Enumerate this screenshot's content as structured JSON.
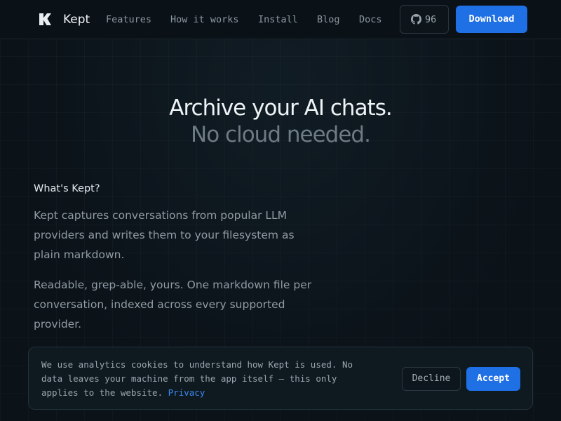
{
  "nav": {
    "brand": "Kept",
    "links": [
      "Features",
      "How it works",
      "Install",
      "Blog",
      "Docs"
    ],
    "github_stars": "96",
    "download_label": "Download"
  },
  "hero": {
    "line1": "Archive your AI chats.",
    "line2": "No cloud needed."
  },
  "about": {
    "heading": "What's Kept?",
    "paragraph1": "Kept captures conversations from popular LLM providers and writes them to your filesystem as plain markdown.",
    "paragraph2": "Readable, grep-able, yours. One markdown file per conversation, indexed across every supported provider."
  },
  "cookie_banner": {
    "message": "We use analytics cookies to understand how Kept is used. No data leaves your machine from the app itself — this only applies to the website. ",
    "privacy_link": "Privacy",
    "decline_label": "Decline",
    "accept_label": "Accept"
  },
  "colors": {
    "background": "#0b1218",
    "accent": "#1f6fe5",
    "link": "#3d88f0",
    "muted_text": "#909ba3"
  },
  "icons": {
    "logo": "kept-k-logo",
    "github": "github-icon"
  }
}
